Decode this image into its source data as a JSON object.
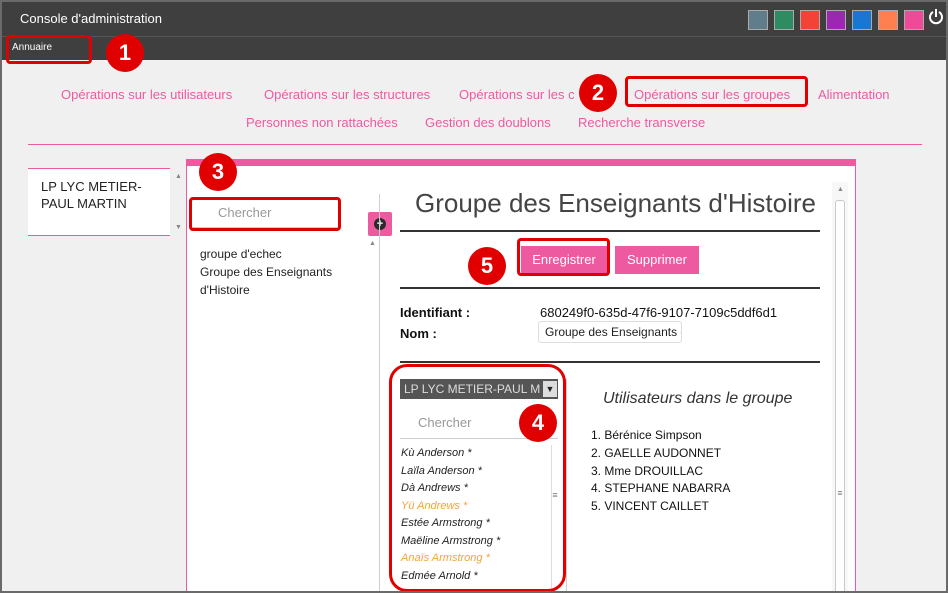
{
  "app": {
    "title": "Console d'administration",
    "breadcrumb": "Annuaire",
    "theme_colors": [
      "#607d8b",
      "#2e8b62",
      "#f44336",
      "#9c27b0",
      "#1976d2",
      "#ff7f50",
      "#ee4a9a"
    ],
    "power_icon": "power-icon"
  },
  "nav": {
    "row1": [
      "Opérations sur les utilisateurs",
      "Opérations sur les structures",
      "Opérations sur les c",
      "Opérations sur les groupes",
      "Alimentation"
    ],
    "row2": [
      "Personnes non rattachées",
      "Gestion des doublons",
      "Recherche transverse"
    ],
    "accent_color": "#ee5aa0"
  },
  "structure": {
    "name": "LP LYC METIER-PAUL MARTIN"
  },
  "groups_panel": {
    "search_placeholder": "Chercher",
    "add_icon": "plus-circle-icon",
    "items": [
      "groupe d'echec",
      "Groupe des Enseignants d'Histoire"
    ]
  },
  "group_detail": {
    "title": "Groupe des Enseignants d'Histoire",
    "save_label": "Enregistrer",
    "delete_label": "Supprimer",
    "id_label": "Identifiant :",
    "id_value": "680249f0-635d-47f6-9107-7109c5ddf6d1",
    "name_label": "Nom :",
    "name_value": "Groupe des Enseignants d",
    "structure_select": "LP LYC METIER-PAUL M",
    "user_search_placeholder": "Chercher",
    "users": [
      {
        "name": "Kù Anderson *",
        "highlight": false
      },
      {
        "name": "Laïla Anderson *",
        "highlight": false
      },
      {
        "name": "Dà Andrews *",
        "highlight": false
      },
      {
        "name": "Yü Andrews *",
        "highlight": true
      },
      {
        "name": "Estée Armstrong *",
        "highlight": false
      },
      {
        "name": "Maëline Armstrong *",
        "highlight": false
      },
      {
        "name": "Anaïs Armstrong *",
        "highlight": true
      },
      {
        "name": "Edmée Arnold *",
        "highlight": false
      }
    ],
    "members_title": "Utilisateurs dans le groupe",
    "members": [
      "1. Bérénice Simpson",
      "2. GAELLE AUDONNET",
      "3. Mme DROUILLAC",
      "4. STEPHANE NABARRA",
      "5. VINCENT CAILLET"
    ]
  },
  "annotations": [
    "1",
    "2",
    "3",
    "4",
    "5"
  ]
}
